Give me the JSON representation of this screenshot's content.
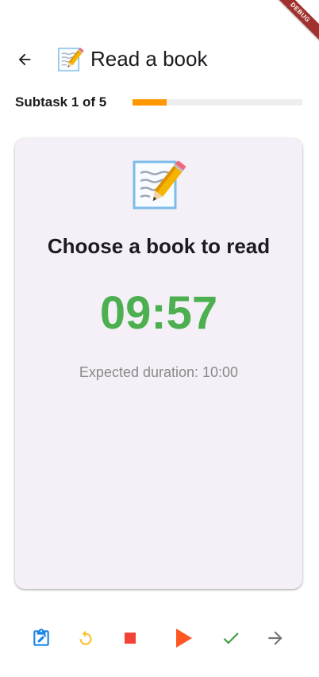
{
  "debug_banner": "DEBUG",
  "app_bar": {
    "title": "Read a book",
    "back_icon": "arrow-back-icon",
    "title_icon": "memo-pencil-icon"
  },
  "progress": {
    "label": "Subtask 1 of 5",
    "current": 1,
    "total": 5,
    "fill_fraction": 0.2,
    "color": "#ff9800"
  },
  "subtask": {
    "icon": "memo-pencil-icon",
    "title": "Choose a book to read",
    "timer": "09:57",
    "timer_color": "#4caf50",
    "expected_duration": "Expected duration: 10:00"
  },
  "actions": [
    {
      "icon": "edit-note-icon",
      "color": "#1e88e5"
    },
    {
      "icon": "restart-icon",
      "color": "#fbc02d"
    },
    {
      "icon": "stop-icon",
      "color": "#f44336"
    },
    {
      "icon": "play-icon",
      "color": "#ff5722"
    },
    {
      "icon": "check-icon",
      "color": "#43a047"
    },
    {
      "icon": "arrow-forward-icon",
      "color": "#757575"
    }
  ]
}
